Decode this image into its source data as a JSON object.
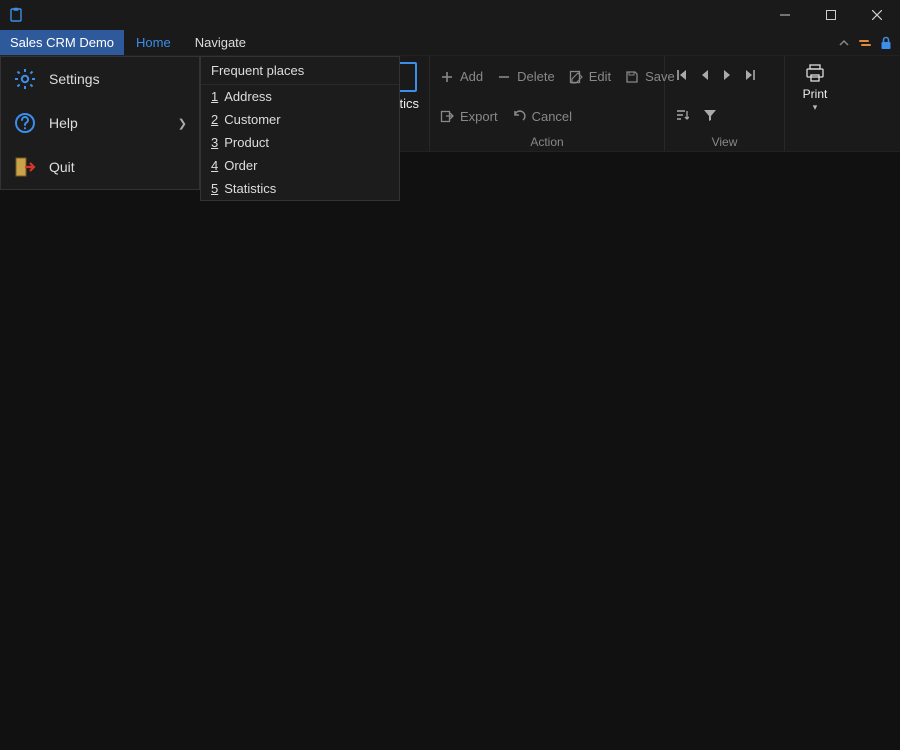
{
  "titlebar": {
    "app_icon": "clipboard-icon"
  },
  "menubar": {
    "app_title": "Sales CRM Demo",
    "items": [
      {
        "label": "Home",
        "active": true
      },
      {
        "label": "Navigate",
        "active": false
      }
    ]
  },
  "ribbon": {
    "nav_partial_label": "stics",
    "action": {
      "label": "Action",
      "buttons": {
        "add": "Add",
        "delete": "Delete",
        "edit": "Edit",
        "save": "Save",
        "export": "Export",
        "cancel": "Cancel"
      }
    },
    "view": {
      "label": "View"
    },
    "print": {
      "label": "Print"
    }
  },
  "app_menu": {
    "items": [
      {
        "label": "Settings",
        "icon": "gear-icon",
        "has_submenu": false
      },
      {
        "label": "Help",
        "icon": "help-icon",
        "has_submenu": true
      },
      {
        "label": "Quit",
        "icon": "exit-icon",
        "has_submenu": false
      }
    ]
  },
  "freq_menu": {
    "header": "Frequent places",
    "items": [
      {
        "num": "1",
        "label": "Address"
      },
      {
        "num": "2",
        "label": "Customer"
      },
      {
        "num": "3",
        "label": "Product"
      },
      {
        "num": "4",
        "label": "Order"
      },
      {
        "num": "5",
        "label": "Statistics"
      }
    ]
  }
}
